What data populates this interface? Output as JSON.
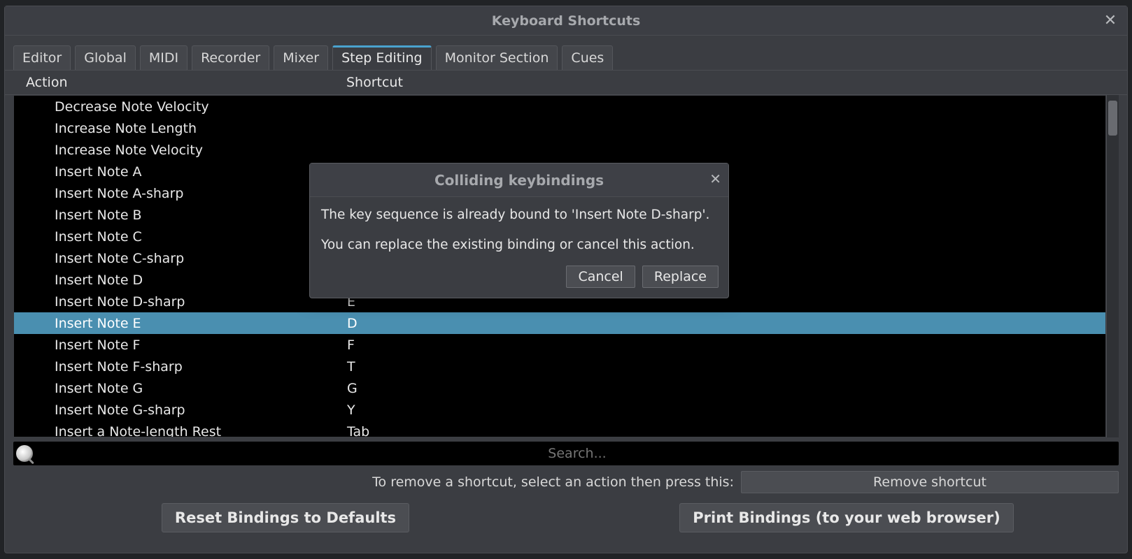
{
  "window": {
    "title": "Keyboard Shortcuts"
  },
  "tabs": [
    {
      "label": "Editor"
    },
    {
      "label": "Global"
    },
    {
      "label": "MIDI"
    },
    {
      "label": "Recorder"
    },
    {
      "label": "Mixer"
    },
    {
      "label": "Step Editing",
      "active": true
    },
    {
      "label": "Monitor Section"
    },
    {
      "label": "Cues"
    }
  ],
  "columns": {
    "action": "Action",
    "shortcut": "Shortcut"
  },
  "rows": [
    {
      "action": "Decrease Note Velocity",
      "shortcut": ""
    },
    {
      "action": "Increase Note Length",
      "shortcut": ""
    },
    {
      "action": "Increase Note Velocity",
      "shortcut": ""
    },
    {
      "action": "Insert Note A",
      "shortcut": ""
    },
    {
      "action": "Insert Note A-sharp",
      "shortcut": ""
    },
    {
      "action": "Insert Note B",
      "shortcut": ""
    },
    {
      "action": "Insert Note C",
      "shortcut": ""
    },
    {
      "action": "Insert Note C-sharp",
      "shortcut": ""
    },
    {
      "action": "Insert Note D",
      "shortcut": ""
    },
    {
      "action": "Insert Note D-sharp",
      "shortcut": "E"
    },
    {
      "action": "Insert Note E",
      "shortcut": "D",
      "selected": true
    },
    {
      "action": "Insert Note F",
      "shortcut": "F"
    },
    {
      "action": "Insert Note F-sharp",
      "shortcut": "T"
    },
    {
      "action": "Insert Note G",
      "shortcut": "G"
    },
    {
      "action": "Insert Note G-sharp",
      "shortcut": "Y"
    },
    {
      "action": "Insert a Note-length Rest",
      "shortcut": "Tab"
    }
  ],
  "search": {
    "placeholder": "Search..."
  },
  "remove": {
    "label": "To remove a shortcut, select an action then press this:",
    "button": "Remove shortcut"
  },
  "bottom": {
    "reset": "Reset Bindings to Defaults",
    "print": "Print Bindings (to your web browser)"
  },
  "dialog": {
    "title": "Colliding keybindings",
    "line1": "The key sequence is already bound to 'Insert Note D-sharp'.",
    "line2": "You can replace the existing binding or cancel this action.",
    "cancel": "Cancel",
    "replace": "Replace"
  }
}
